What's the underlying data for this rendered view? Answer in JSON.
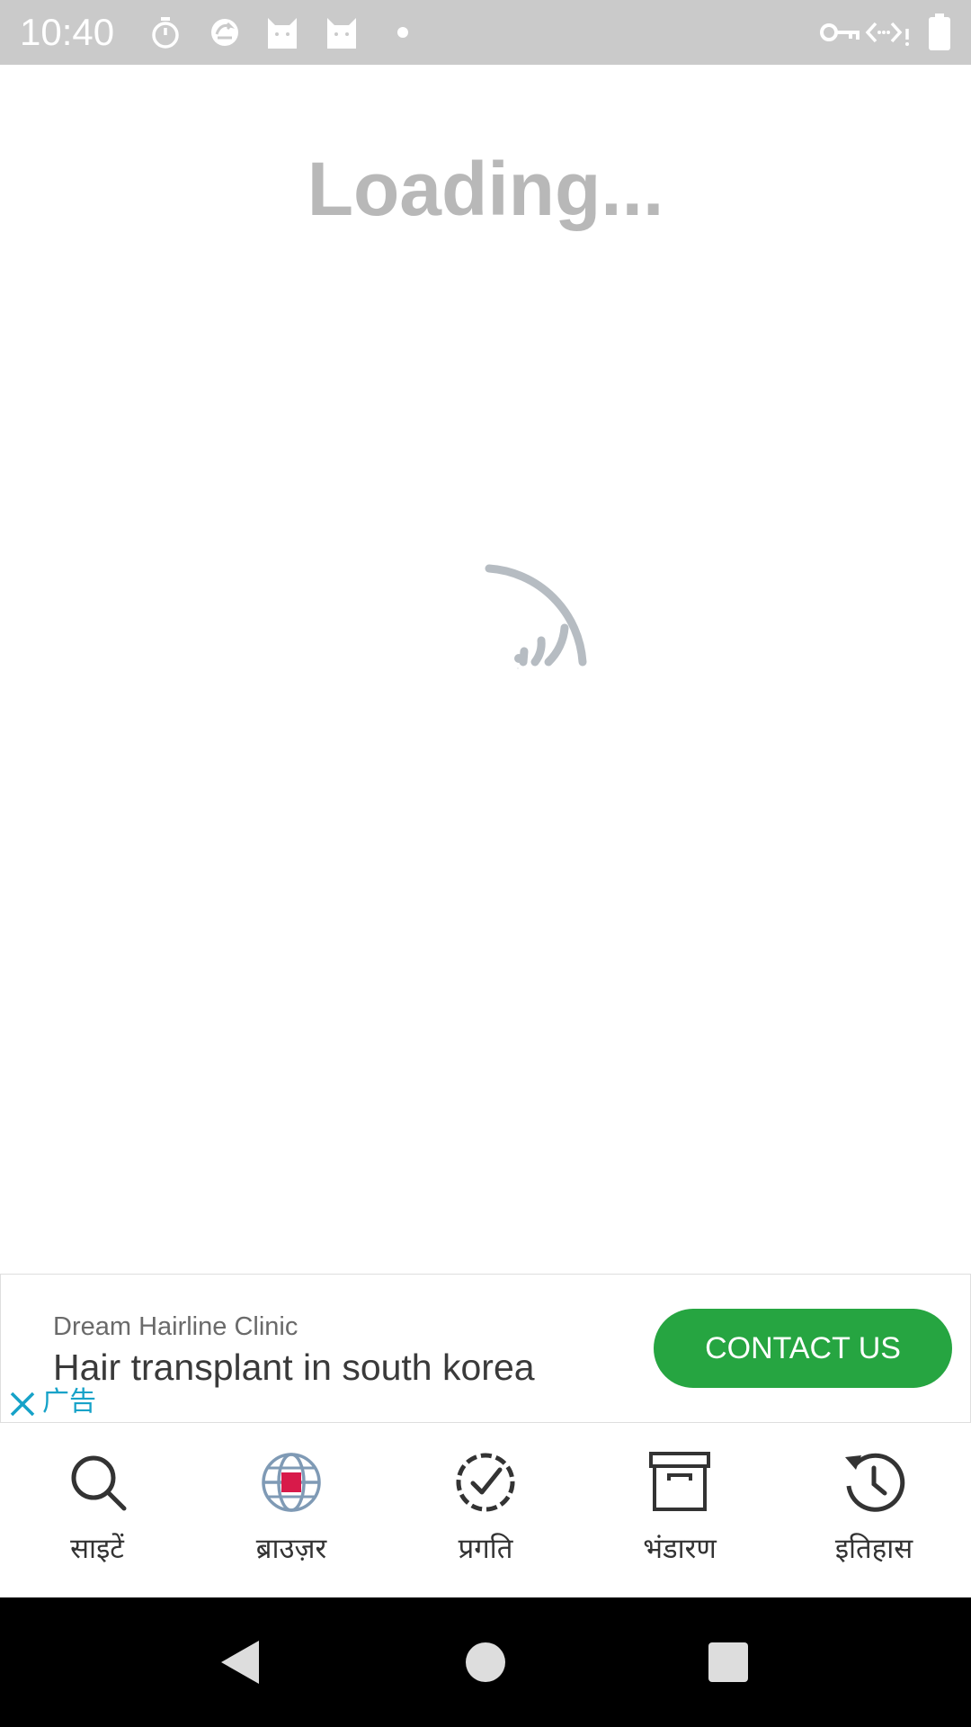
{
  "status_bar": {
    "time": "10:40",
    "left_icons": [
      "stopwatch-icon",
      "sync-icon",
      "cat-icon",
      "cat-icon",
      "dot-icon"
    ],
    "right_icons": [
      "vpn-key-icon",
      "data-icon",
      "battery-icon"
    ]
  },
  "main": {
    "loading_text": "Loading..."
  },
  "ad": {
    "advertiser": "Dream Hairline Clinic",
    "headline": "Hair transplant in south korea",
    "label": "广告",
    "cta_label": "CONTACT US",
    "cta_color": "#26a541",
    "label_color": "#16a2c8"
  },
  "bottom_nav": {
    "items": [
      {
        "label": "साइटें",
        "icon": "search-icon"
      },
      {
        "label": "ब्राउज़र",
        "icon": "globe-icon"
      },
      {
        "label": "प्रगति",
        "icon": "progress-check-icon"
      },
      {
        "label": "भंडारण",
        "icon": "archive-icon"
      },
      {
        "label": "इतिहास",
        "icon": "history-icon"
      }
    ]
  },
  "system_nav": {
    "buttons": [
      "back-icon",
      "home-icon",
      "recents-icon"
    ]
  }
}
